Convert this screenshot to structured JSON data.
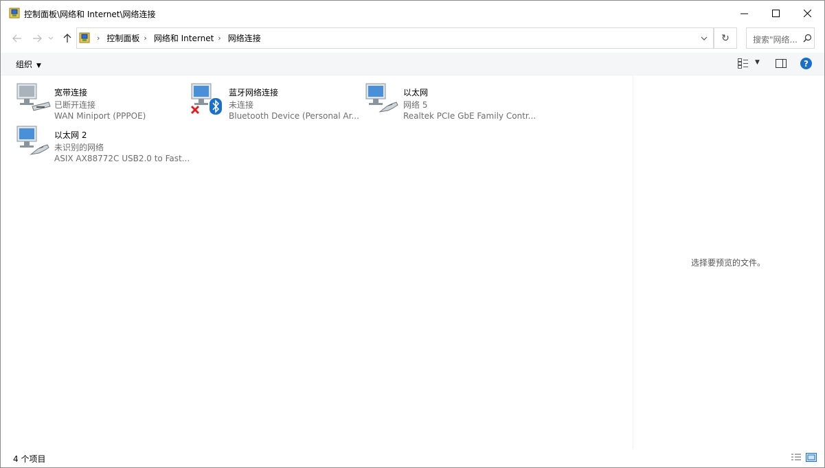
{
  "window": {
    "title": "控制面板\\网络和 Internet\\网络连接",
    "icons": [
      "network-connections-icon",
      "minimize-icon",
      "maximize-icon",
      "close-icon"
    ]
  },
  "nav": {
    "breadcrumbs": [
      "控制面板",
      "网络和 Internet",
      "网络连接"
    ],
    "search_placeholder": "搜索\"网络..."
  },
  "toolbar": {
    "organize_label": "组织"
  },
  "items": [
    {
      "name": "宽带连接",
      "status": "已断开连接",
      "device": "WAN Miniport (PPPOE)",
      "icon": "broadband-modem-icon"
    },
    {
      "name": "蓝牙网络连接",
      "status": "未连接",
      "device": "Bluetooth Device (Personal Ar...",
      "icon": "bluetooth-icon"
    },
    {
      "name": "以太网",
      "status": "网络 5",
      "device": "Realtek PCIe GbE Family Contr...",
      "icon": "ethernet-icon"
    },
    {
      "name": "以太网 2",
      "status": "未识别的网络",
      "device": "ASIX AX88772C USB2.0 to Fast...",
      "icon": "ethernet-icon"
    }
  ],
  "preview_pane": {
    "message": "选择要预览的文件。"
  },
  "status_bar": {
    "count": "4 个项目"
  },
  "colors": {
    "accent": "#1a6fc9",
    "toolbar_bg": "#f5f6f7",
    "muted_text": "#6d6d6d",
    "error_red": "#e01e1e"
  }
}
